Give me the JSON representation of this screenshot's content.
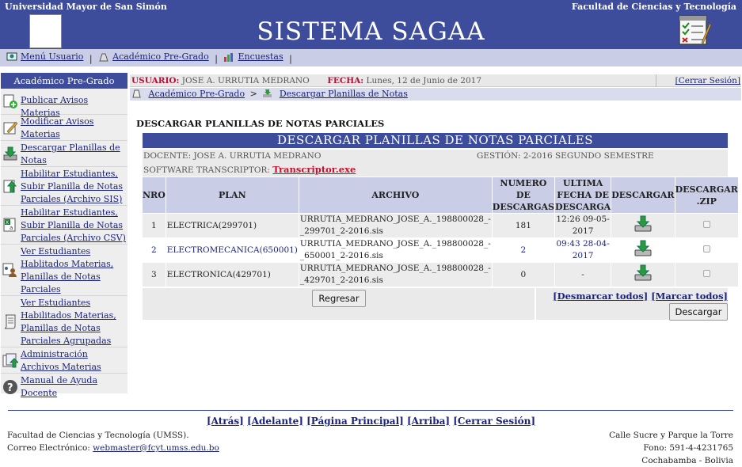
{
  "header": {
    "left": "Universidad Mayor de San Simón",
    "right": "Facultad de Ciencias y Tecnología",
    "title": "SISTEMA SAGAA"
  },
  "topmenu": {
    "items": [
      "Menú Usuario",
      "Académico Pre-Grado",
      "Encuestas"
    ],
    "separator": "|"
  },
  "sidebar": {
    "title": "Académico Pre-Grado",
    "items": [
      {
        "label": "Publicar Avisos Materias",
        "icon": "add-page-icon"
      },
      {
        "label": "Modificar Avisos Materias",
        "icon": "edit-icon"
      },
      {
        "label": "Descargar Planillas de Notas",
        "icon": "download-icon"
      },
      {
        "label": "Habilitar Estudiantes, Subir Planilla de Notas Parciales (Archivo SIS)",
        "icon": "upload-sis-icon"
      },
      {
        "label": "Habilitar Estudiantes, Subir Planilla de Notas Parciales (Archivo CSV)",
        "icon": "csv-file-icon"
      },
      {
        "label": "Ver Estudiantes Hablitados Materias, Planillas de Notas Parciales",
        "icon": "students-icon"
      },
      {
        "label": "Ver Estudiantes Habilitados Materias, Planillas de Notas Parciales Agrupadas",
        "icon": "scroll-icon"
      },
      {
        "label": "Administración Archivos Materias",
        "icon": "files-icon"
      },
      {
        "label": "Manual de Ayuda Docente",
        "icon": "help-icon"
      }
    ]
  },
  "userbar": {
    "user_label": "USUARIO:",
    "user_value": "JOSE A. URRUTIA MEDRANO",
    "date_label": "FECHA:",
    "date_value": "Lunes, 12 de Junio de 2017",
    "logout": "[Cerrar Sesión]"
  },
  "breadcrumb": {
    "first": "Académico Pre-Grado",
    "sep": ">",
    "second": "Descargar Planillas de Notas"
  },
  "main": {
    "heading": "DESCARGAR PLANILLAS DE NOTAS PARCIALES",
    "panel_title": "DESCARGAR PLANILLAS DE NOTAS PARCIALES",
    "docente": "DOCENTE: JOSE A. URRUTIA MEDRANO",
    "gestion": "GESTIÓN: 2-2016 SEGUNDO SEMESTRE",
    "software_label": "SOFTWARE TRANSCRIPTOR:",
    "software_link": "Transcriptor.exe",
    "columns": [
      "NRO",
      "PLAN",
      "ARCHIVO",
      "NUMERO DE DESCARGAS",
      "ULTIMA FECHA DE DESCARGA",
      "DESCARGAR",
      "DESCARGAR .ZIP"
    ],
    "rows": [
      {
        "nro": "1",
        "plan": "ELECTRICA(299701)",
        "archivo": "URRUTIA_MEDRANO_JOSE_A._198800028_-_299701_2-2016.sis",
        "descargas": "181",
        "fecha": "12:26 09-05-2017"
      },
      {
        "nro": "2",
        "plan": "ELECTROMECANICA(650001)",
        "archivo": "URRUTIA_MEDRANO_JOSE_A._198800028_-_650001_2-2016.sis",
        "descargas": "2",
        "fecha": "09:43 28-04-2017"
      },
      {
        "nro": "3",
        "plan": "ELECTRONICA(429701)",
        "archivo": "URRUTIA_MEDRANO_JOSE_A._198800028_-_429701_2-2016.sis",
        "descargas": "0",
        "fecha": "-"
      }
    ],
    "back_button": "Regresar",
    "unmark_all": "[Desmarcar todos]",
    "mark_all": "[Marcar todos]",
    "download_button": "Descargar"
  },
  "footer": {
    "nav": [
      "[Atrás]",
      "[Adelante]",
      "[Página Principal]",
      "[Arriba]",
      "[Cerrar Sesión]"
    ],
    "left_line1": "Facultad de Ciencias y Tecnología (UMSS).",
    "left_line2_label": "Correo Electrónico:",
    "email": "webmaster@fcyt.umss.edu.bo",
    "right_line1": "Calle Sucre y Parque la Torre",
    "right_line2": "Fono: 591-4-4231765",
    "right_line3": "Cochabamba - Bolivia"
  },
  "colors": {
    "header_blue": "#3d4d9c",
    "menu_lavender": "#c9cde6",
    "label_red": "#b0123a",
    "link_blue": "#1a237e"
  }
}
